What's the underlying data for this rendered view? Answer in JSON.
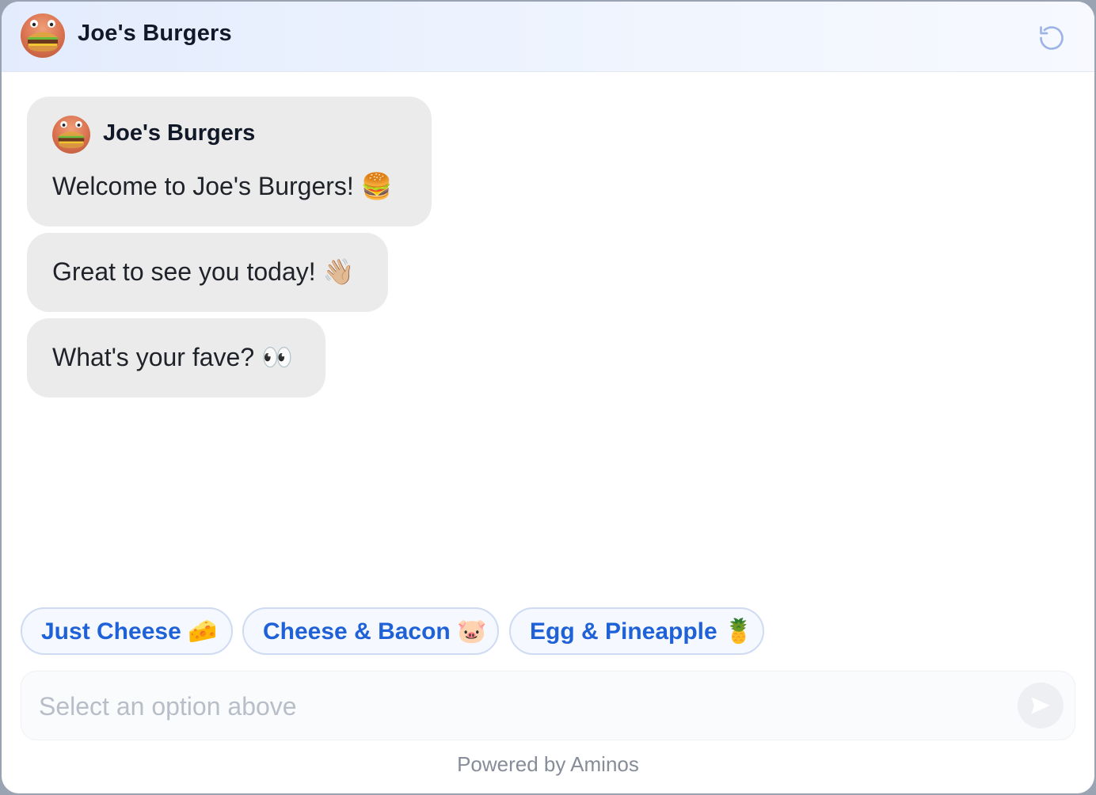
{
  "header": {
    "title": "Joe's Burgers",
    "reset_icon": "refresh-icon"
  },
  "messages": [
    {
      "sender": "Joe's Burgers",
      "text": "Welcome to Joe's Burgers! 🍔"
    },
    {
      "text": "Great to see you today! 👋🏼"
    },
    {
      "text": "What's your fave? 👀"
    }
  ],
  "quick_replies": [
    {
      "label": "Just Cheese 🧀"
    },
    {
      "label": "Cheese & Bacon 🐷"
    },
    {
      "label": "Egg & Pineapple 🍍"
    }
  ],
  "composer": {
    "placeholder": "Select an option above",
    "send_icon": "send-icon"
  },
  "footer": {
    "text": "Powered by Aminos"
  },
  "colors": {
    "accent": "#1f62d8",
    "bubble_bg": "#ebebeb",
    "header_bg": "#e3ecfd"
  }
}
